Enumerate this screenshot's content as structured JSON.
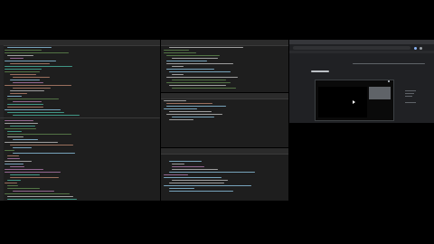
{
  "screen": {
    "background": "#000000",
    "editor_background": "#1e1e1e",
    "accent": "#8ab4f8",
    "icons": [
      "search-icon",
      "close-icon",
      "play-icon"
    ]
  },
  "browser": {
    "tab_title": "",
    "address": "",
    "page_heading": "",
    "video_title": ""
  }
}
